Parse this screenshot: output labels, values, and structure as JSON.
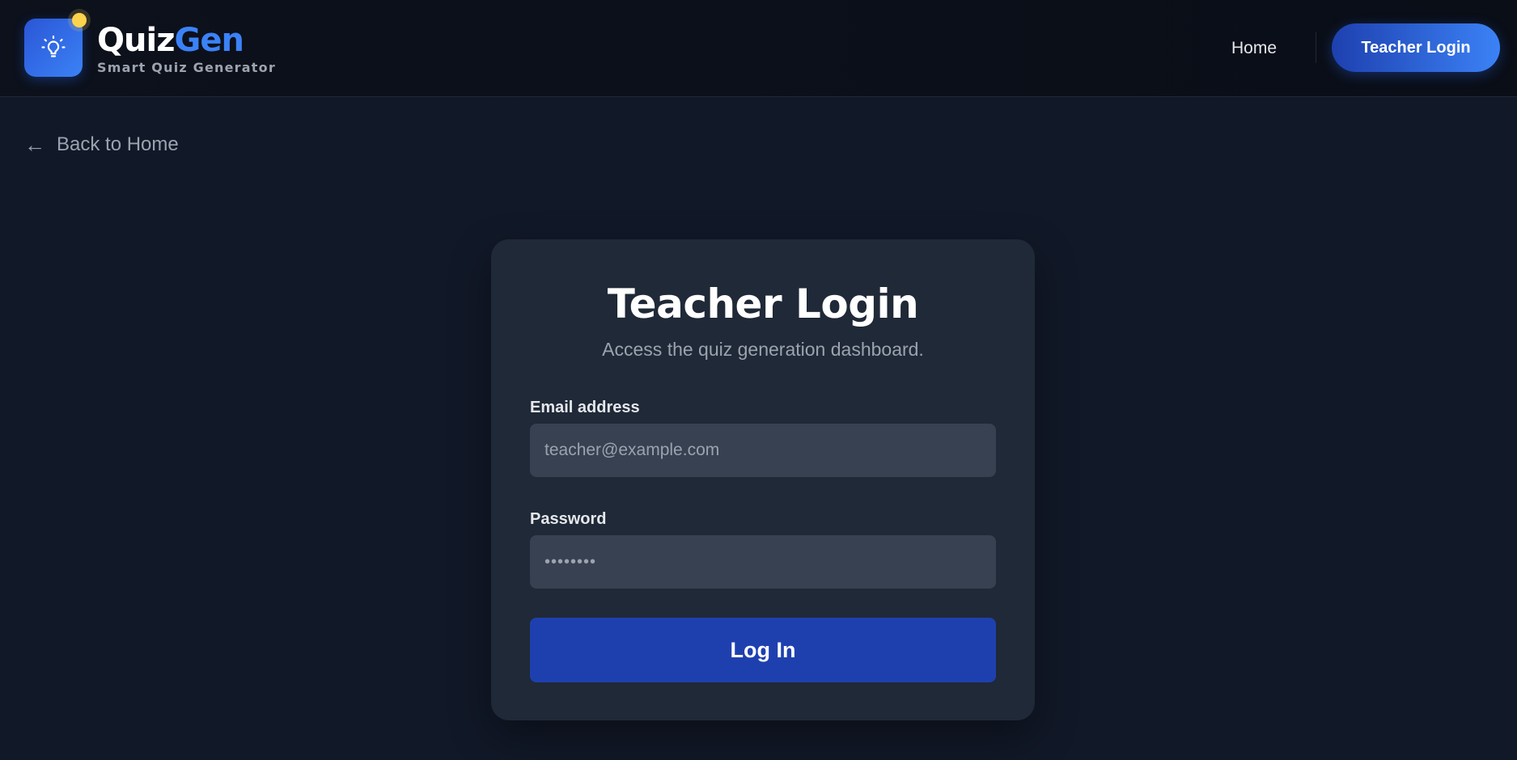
{
  "header": {
    "brand_part1": "Quiz",
    "brand_part2": "Gen",
    "tagline": "Smart Quiz Generator",
    "logo_icon": "lightbulb-icon",
    "nav": {
      "home_label": "Home",
      "login_label": "Teacher Login"
    }
  },
  "back_link": {
    "arrow": "←",
    "label": "Back to Home"
  },
  "login_card": {
    "title": "Teacher Login",
    "subtitle": "Access the quiz generation dashboard.",
    "email": {
      "label": "Email address",
      "placeholder": "teacher@example.com",
      "value": ""
    },
    "password": {
      "label": "Password",
      "placeholder": "",
      "value": "password"
    },
    "submit_label": "Log In"
  },
  "colors": {
    "page_bg": "#111827",
    "header_bg": "#0c111c",
    "card_bg": "#1f2937",
    "input_bg": "#374151",
    "accent": "#3b82f6",
    "button_bg": "#1e40af",
    "status_dot": "#fcd34d",
    "muted_text": "#9ca3af"
  }
}
